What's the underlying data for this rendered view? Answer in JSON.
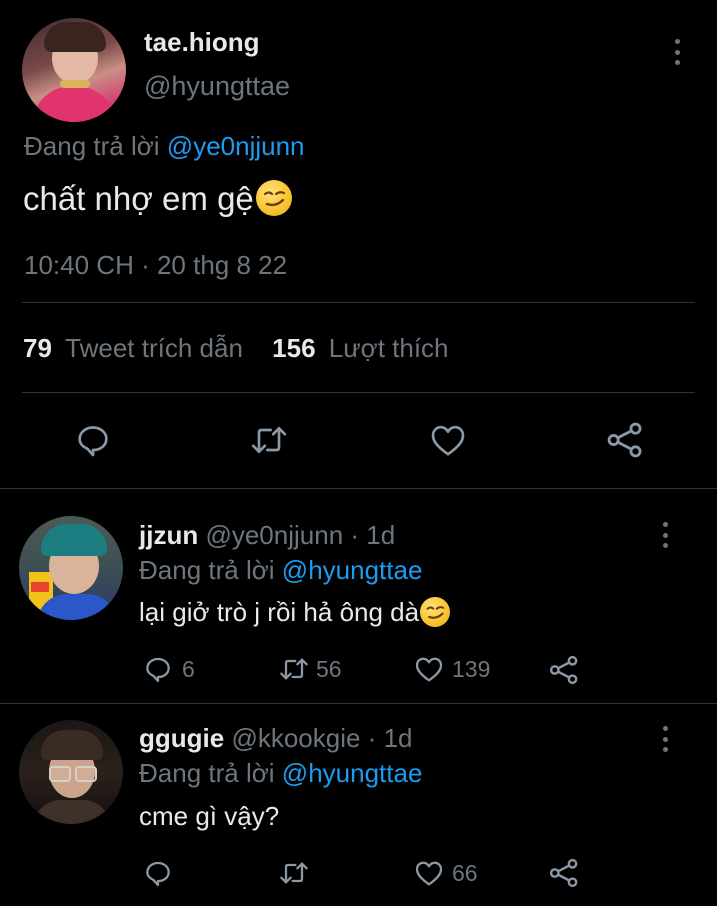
{
  "main_tweet": {
    "display_name": "tae.hiong",
    "handle": "@hyungttae",
    "replying_prefix": "Đang trả lời",
    "replying_to": "@ye0njjunn",
    "text": "chất nhợ em gệ",
    "timestamp": "10:40 CH · 20 thg 8 22",
    "quote_count": "79",
    "quote_label": "Tweet trích dẫn",
    "like_count": "156",
    "like_label": "Lượt thích"
  },
  "replies": [
    {
      "display_name": "jjzun",
      "handle": "@ye0njjunn",
      "time": "· 1d",
      "replying_prefix": "Đang trả lời",
      "replying_to": "@hyungttae",
      "text": "lại giở trò j rồi hả ông dà",
      "reply_count": "6",
      "retweet_count": "56",
      "like_count": "139"
    },
    {
      "display_name": "ggugie",
      "handle": "@kkookgie",
      "time": "· 1d",
      "replying_prefix": "Đang trả lời",
      "replying_to": "@hyungttae",
      "text": "cme gì vậy?",
      "reply_count": "",
      "retweet_count": "",
      "like_count": "66"
    }
  ],
  "icons": {
    "reply": "reply-icon",
    "retweet": "retweet-icon",
    "like": "heart-icon",
    "share": "share-icon",
    "more": "more-options-icon",
    "emoji": "smirking-face-emoji"
  },
  "colors": {
    "background": "#000000",
    "text": "#e7e9ea",
    "muted": "#6e767d",
    "link": "#1d9bf0",
    "divider": "#2f3336"
  }
}
